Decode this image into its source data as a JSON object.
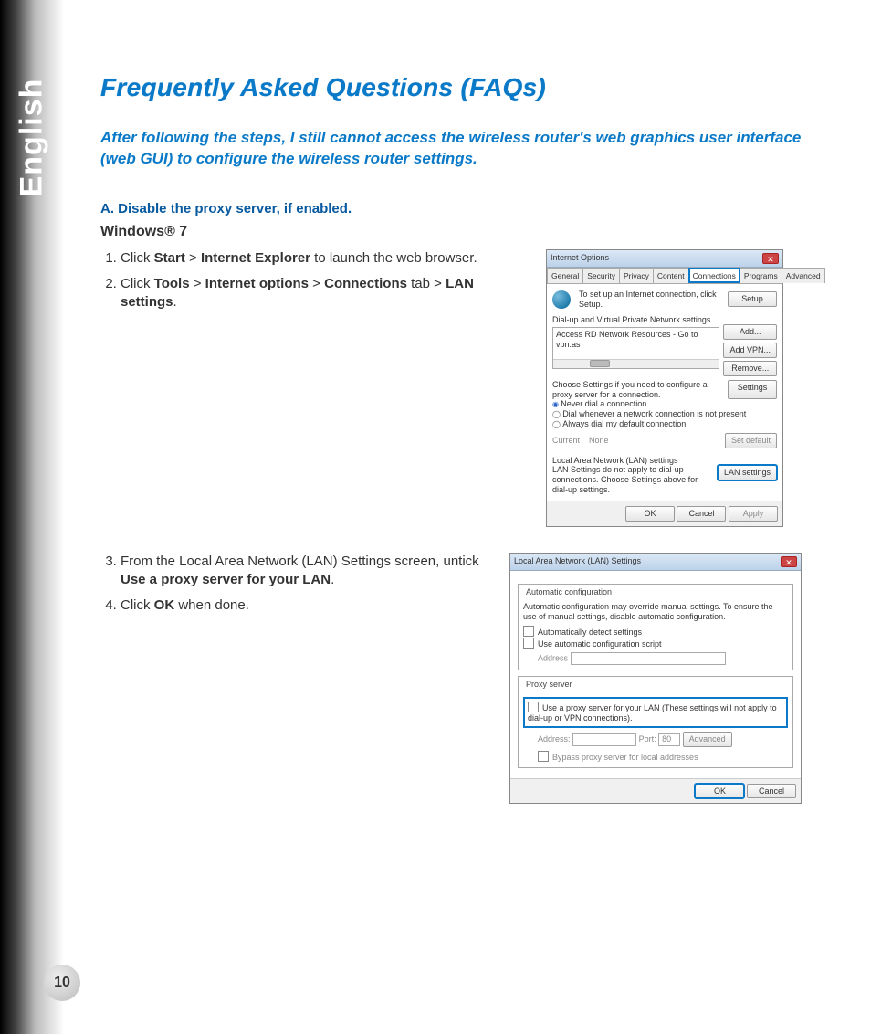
{
  "page": {
    "language": "English",
    "number": "10"
  },
  "heading": "Frequently Asked Questions (FAQs)",
  "question": "After following the steps, I still cannot access the wireless router's web graphics user interface (web GUI) to configure the wireless router settings.",
  "sectionA": {
    "label": "A.   Disable the proxy server, if enabled.",
    "os": "Windows® 7"
  },
  "steps12": {
    "s1_a": "Click ",
    "s1_b1": "Start",
    "s1_c": " > ",
    "s1_b2": "Internet Explorer",
    "s1_d": " to launch the web browser.",
    "s2_a": "Click ",
    "s2_b1": "Tools",
    "s2_c": " > ",
    "s2_b2": "Internet options",
    "s2_d": " > ",
    "s2_b3": "Connections",
    "s2_e": " tab > ",
    "s2_b4": "LAN settings",
    "s2_f": "."
  },
  "steps34": {
    "s3_a": "From the Local Area Network (LAN) Settings screen, untick ",
    "s3_b": "Use a proxy server for your LAN",
    "s3_c": ".",
    "s4_a": "Click ",
    "s4_b": "OK",
    "s4_c": " when done."
  },
  "ieDialog": {
    "title": "Internet Options",
    "tabs": [
      "General",
      "Security",
      "Privacy",
      "Content",
      "Connections",
      "Programs",
      "Advanced"
    ],
    "activeTab": "Connections",
    "setupTxt": "To set up an Internet connection, click Setup.",
    "setupBtn": "Setup",
    "dunHeader": "Dial-up and Virtual Private Network settings",
    "dunItem": "Access RD Network Resources - Go to vpn.as",
    "addBtn": "Add...",
    "addVpnBtn": "Add VPN...",
    "removeBtn": "Remove...",
    "chooseTxt": "Choose Settings if you need to configure a proxy server for a connection.",
    "settingsBtn": "Settings",
    "r1": "Never dial a connection",
    "r2": "Dial whenever a network connection is not present",
    "r3": "Always dial my default connection",
    "currentLbl": "Current",
    "currentVal": "None",
    "setDefaultBtn": "Set default",
    "lanHeader": "Local Area Network (LAN) settings",
    "lanTxt": "LAN Settings do not apply to dial-up connections. Choose Settings above for dial-up settings.",
    "lanBtn": "LAN settings",
    "ok": "OK",
    "cancel": "Cancel",
    "apply": "Apply"
  },
  "lanDialog": {
    "title": "Local Area Network (LAN) Settings",
    "grp1": "Automatic configuration",
    "grp1txt": "Automatic configuration may override manual settings.  To ensure the use of manual settings, disable automatic configuration.",
    "chk1": "Automatically detect settings",
    "chk2": "Use automatic configuration script",
    "addrLbl": "Address",
    "grp2": "Proxy server",
    "proxyChk": "Use a proxy server for your LAN (These settings will not apply to dial-up or VPN connections).",
    "addr2": "Address:",
    "portLbl": "Port:",
    "portVal": "80",
    "advBtn": "Advanced",
    "bypass": "Bypass proxy server for local addresses",
    "ok": "OK",
    "cancel": "Cancel"
  }
}
